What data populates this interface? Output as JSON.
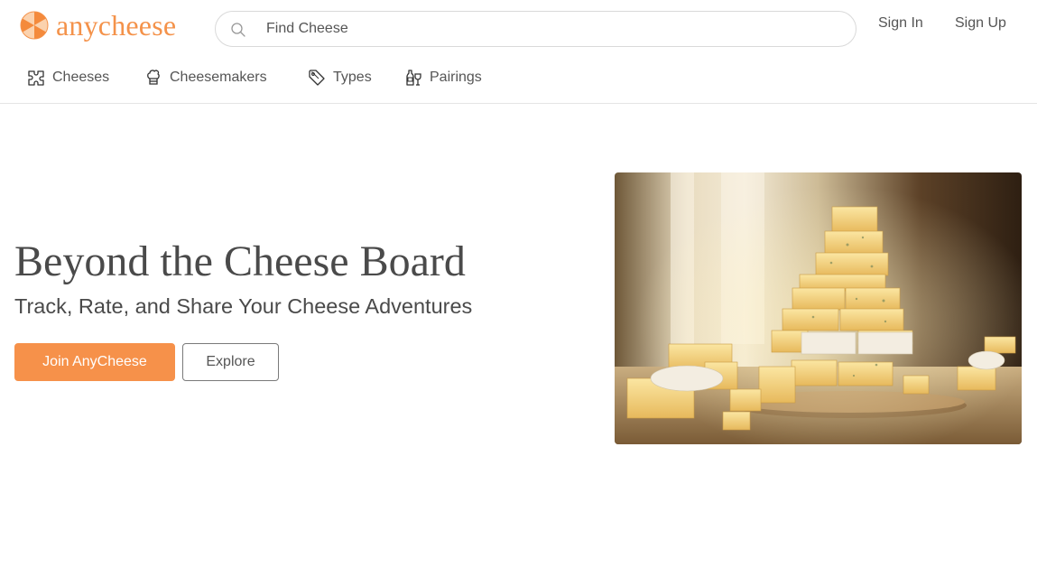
{
  "brand": {
    "name": "anycheese",
    "accent": "#f4924a"
  },
  "search": {
    "placeholder": "Find Cheese",
    "icon": "search-icon"
  },
  "auth": {
    "sign_in": "Sign In",
    "sign_up": "Sign Up"
  },
  "nav": {
    "items": [
      {
        "label": "Cheeses",
        "icon": "puzzle-icon"
      },
      {
        "label": "Cheesemakers",
        "icon": "chef-hat-icon"
      },
      {
        "label": "Types",
        "icon": "tag-icon"
      },
      {
        "label": "Pairings",
        "icon": "wine-bottle-glass-icon"
      }
    ]
  },
  "hero": {
    "title": "Beyond the Cheese Board",
    "subtitle": "Track, Rate, and Share Your Cheese Adventures",
    "primary_button": "Join AnyCheese",
    "secondary_button": "Explore",
    "image": "cheese-tower-photo"
  },
  "colors": {
    "button_primary": "#f6914a",
    "text": "#4a4a4a",
    "border": "#d9d9d9"
  }
}
